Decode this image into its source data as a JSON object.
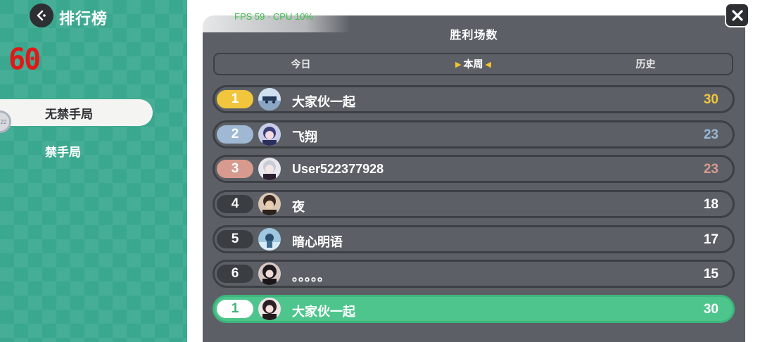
{
  "header": {
    "title": "排行榜"
  },
  "fps_counter": "60",
  "nav": {
    "items": [
      {
        "label": "无禁手局",
        "active": true
      },
      {
        "label": "禁手局",
        "active": false
      }
    ],
    "badge_text": "22"
  },
  "overlay": {
    "fps_text": "FPS 59 · CPU 10%"
  },
  "board": {
    "title": "胜利场数",
    "tabs": [
      {
        "label": "今日",
        "active": false
      },
      {
        "label": "本周",
        "active": true
      },
      {
        "label": "历史",
        "active": false
      }
    ],
    "rows": [
      {
        "rank": "1",
        "name": "大家伙一起",
        "score": "30",
        "rank_color": "#f2c63c",
        "score_color": "#f2c63c",
        "rank_text_color": "#ffffff"
      },
      {
        "rank": "2",
        "name": "飞翔",
        "score": "23",
        "rank_color": "#9fb9d4",
        "score_color": "#98b6d4",
        "rank_text_color": "#ffffff"
      },
      {
        "rank": "3",
        "name": "User522377928",
        "score": "23",
        "rank_color": "#d89a8e",
        "score_color": "#d89a8e",
        "rank_text_color": "#ffffff"
      },
      {
        "rank": "4",
        "name": "夜",
        "score": "18",
        "rank_color": "#3a3d42",
        "score_color": "#ffffff",
        "rank_text_color": "#ffffff"
      },
      {
        "rank": "5",
        "name": "暗心明语",
        "score": "17",
        "rank_color": "#3a3d42",
        "score_color": "#ffffff",
        "rank_text_color": "#ffffff"
      },
      {
        "rank": "6",
        "name": "。。。。。",
        "score": "15",
        "rank_color": "#3a3d42",
        "score_color": "#ffffff",
        "rank_text_color": "#ffffff"
      }
    ],
    "my_row": {
      "rank": "1",
      "name": "大家伙一起",
      "score": "30",
      "rank_color": "#ffffff",
      "score_color": "#ffffff",
      "rank_text_color": "#3db57d"
    }
  },
  "icons": {
    "back": "back-arrow-icon",
    "close": "close-icon"
  },
  "colors": {
    "accent_green": "#3aa88f",
    "board_bg": "#5c6066",
    "fps_red": "#e01818",
    "highlight_row": "#4ec58d"
  }
}
